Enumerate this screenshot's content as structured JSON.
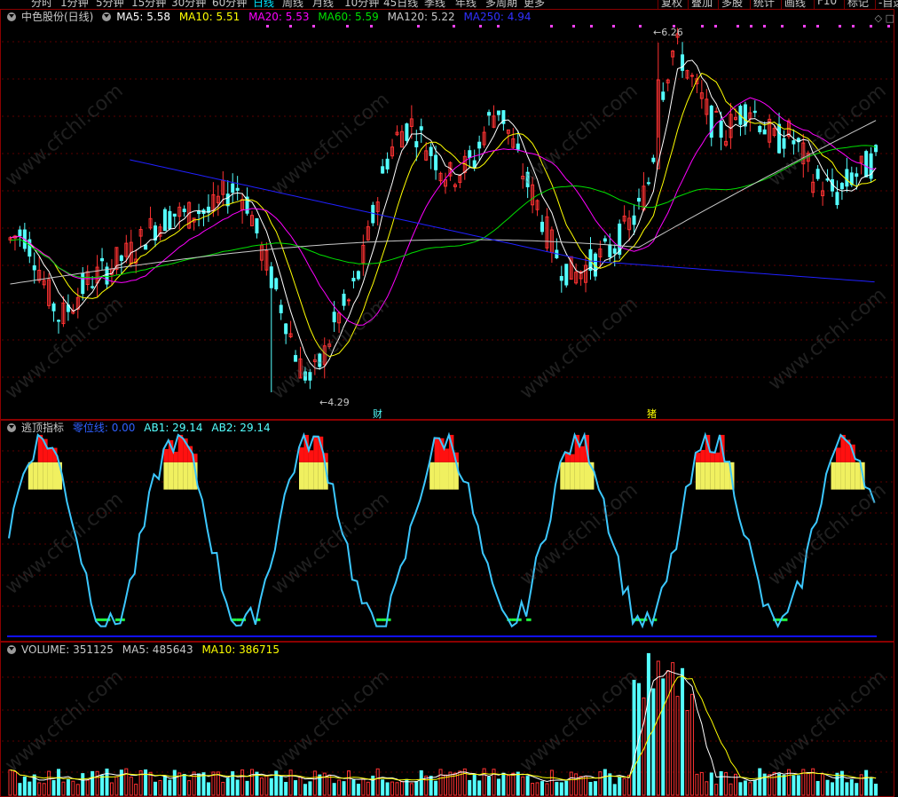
{
  "toolbar": {
    "periods": [
      "分时",
      "1分钟",
      "5分钟",
      "15分钟",
      "30分钟",
      "60分钟",
      "日线",
      "周线",
      "月线",
      "10分钟",
      "45日线",
      "季线",
      "年线",
      "多周期",
      "更多"
    ],
    "active_period": "日线",
    "right_items": [
      "复权",
      "叠加",
      "多股",
      "统计",
      "画线",
      "F10",
      "标记",
      "-自选"
    ]
  },
  "price_panel": {
    "stock_name": "中色股份(日线)",
    "ma5": "MA5: 5.58",
    "ma10": "MA10: 5.51",
    "ma20": "MA20: 5.53",
    "ma60": "MA60: 5.59",
    "ma120": "MA120: 5.22",
    "ma250": "MA250: 4.94",
    "high_label": "6.26",
    "low_label": "4.29",
    "marker_cai": "财",
    "marker_tui": "猪",
    "corner_diamond": "◇",
    "corner_box": "□"
  },
  "indicator_panel": {
    "name": "逃顶指标",
    "zero_line": "零位线: 0.00",
    "ab1": "AB1: 29.14",
    "ab2": "AB2: 29.14"
  },
  "volume_panel": {
    "volume": "VOLUME: 351125",
    "ma5": "MA5: 485643",
    "ma10": "MA10: 386715"
  },
  "watermark": "www.cfchi.com",
  "colors": {
    "up": "#ff3232",
    "down": "#54ffff",
    "ma5": "#ffffff",
    "ma10": "#ffff00",
    "ma20": "#ff00ff",
    "ma60": "#00e000",
    "ma120": "#c8c8c8",
    "ma250": "#2020ff",
    "indicator": "#3cc8ff",
    "border": "#8b0000"
  },
  "chart_data": {
    "type": "candlestick",
    "series_close_hint": [
      5.15,
      5.2,
      5.05,
      4.85,
      4.7,
      4.8,
      4.9,
      4.95,
      5.0,
      5.05,
      5.1,
      5.2,
      5.25,
      5.3,
      5.28,
      5.32,
      5.3,
      5.4,
      5.45,
      5.35,
      5.1,
      4.9,
      4.7,
      4.45,
      4.35,
      4.5,
      4.7,
      4.8,
      5.0,
      5.3,
      5.6,
      5.75,
      5.8,
      5.7,
      5.6,
      5.5,
      5.55,
      5.6,
      5.8,
      5.9,
      5.7,
      5.5,
      5.35,
      5.15,
      5.0,
      4.95,
      5.0,
      5.05,
      5.1,
      5.2,
      5.3,
      5.5,
      6.0,
      6.26,
      6.1,
      5.95,
      5.8,
      5.75,
      5.85,
      5.9,
      5.8,
      5.7,
      5.75,
      5.65,
      5.5,
      5.45,
      5.4,
      5.5,
      5.55,
      5.6
    ],
    "price_high": "6.26",
    "price_low": "4.29"
  }
}
